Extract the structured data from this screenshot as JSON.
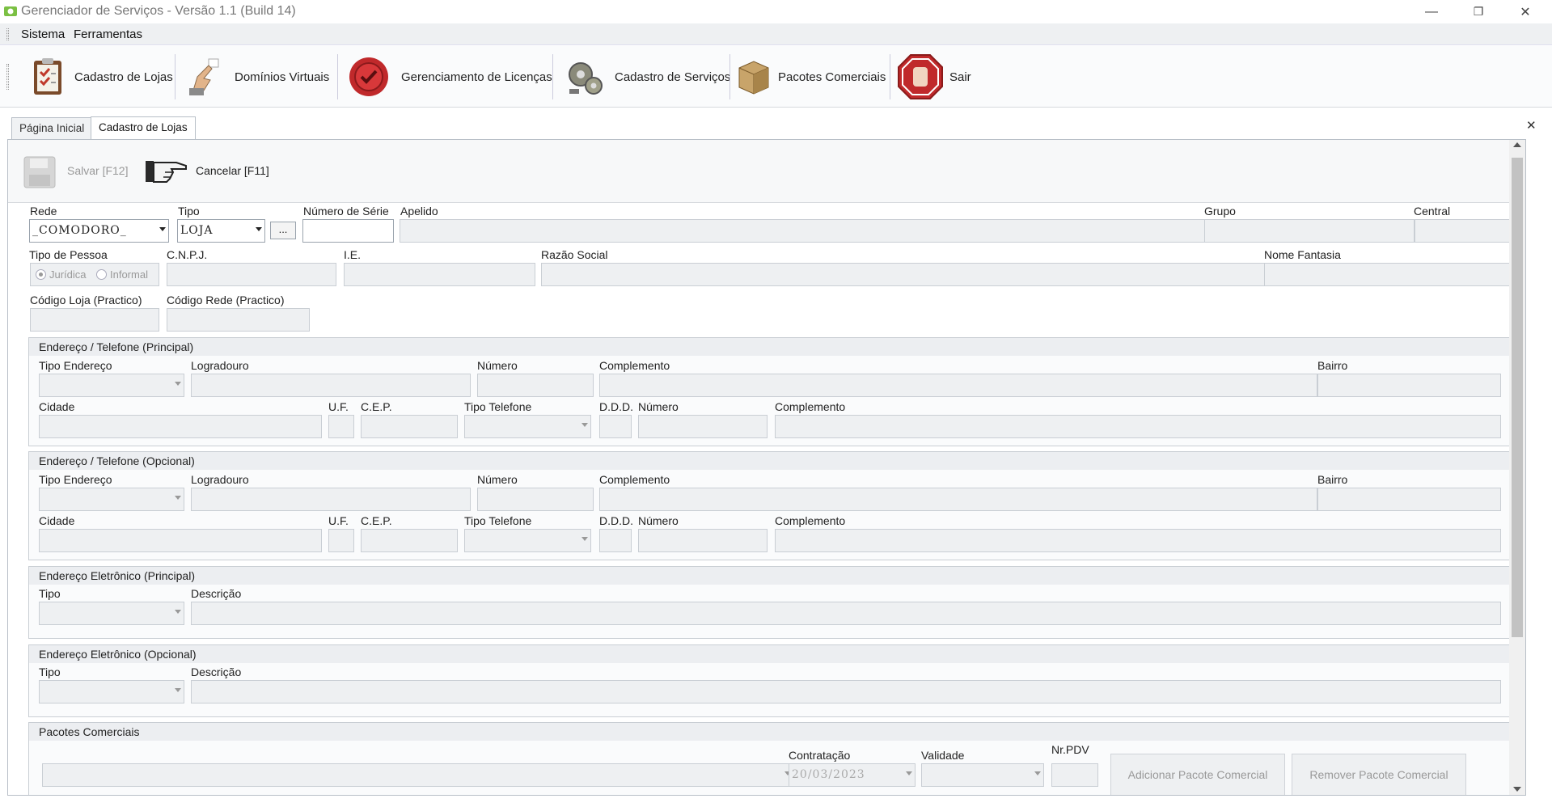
{
  "window": {
    "title": "Gerenciador de Serviços - Versão 1.1 (Build 14)",
    "minimize": "—",
    "restore": "❐",
    "close": "✕"
  },
  "menu": {
    "items": [
      "Sistema",
      "Ferramentas"
    ]
  },
  "toolbar": {
    "items": [
      {
        "label": "Cadastro de Lojas",
        "icon": "clipboard-icon"
      },
      {
        "label": "Domínios Virtuais",
        "icon": "hand-pointer-icon"
      },
      {
        "label": "Gerenciamento de Licenças",
        "icon": "wax-seal-icon"
      },
      {
        "label": "Cadastro de Serviços",
        "icon": "gears-icon"
      },
      {
        "label": "Pacotes Comerciais",
        "icon": "box-icon"
      },
      {
        "label": "Sair",
        "icon": "stop-hand-icon"
      }
    ]
  },
  "tabs": {
    "items": [
      "Página Inicial",
      "Cadastro de Lojas"
    ],
    "close": "✕"
  },
  "actions": {
    "save": "Salvar [F12]",
    "cancel": "Cancelar [F11]"
  },
  "form": {
    "rede": {
      "label": "Rede",
      "value": "_COMODORO_"
    },
    "tipo": {
      "label": "Tipo",
      "value": "LOJA"
    },
    "ellipsis": "...",
    "numero_serie": {
      "label": "Número de Série"
    },
    "apelido": {
      "label": "Apelido"
    },
    "grupo": {
      "label": "Grupo"
    },
    "central": {
      "label": "Central"
    },
    "tipo_pessoa": {
      "label": "Tipo de Pessoa",
      "opt1": "Jurídica",
      "opt2": "Informal"
    },
    "cnpj": {
      "label": "C.N.P.J."
    },
    "ie": {
      "label": "I.E."
    },
    "razao_social": {
      "label": "Razão Social"
    },
    "nome_fantasia": {
      "label": "Nome Fantasia"
    },
    "codigo_loja": {
      "label": "Código Loja (Practico)"
    },
    "codigo_rede": {
      "label": "Código Rede (Practico)"
    }
  },
  "address_labels": {
    "tipo_endereco": "Tipo Endereço",
    "logradouro": "Logradouro",
    "numero": "Número",
    "complemento": "Complemento",
    "bairro": "Bairro",
    "cidade": "Cidade",
    "uf": "U.F.",
    "cep": "C.E.P.",
    "tipo_telefone": "Tipo Telefone",
    "ddd": "D.D.D.",
    "numero_tel": "Número",
    "complemento_tel": "Complemento"
  },
  "groups": {
    "addr_principal": "Endereço / Telefone (Principal)",
    "addr_opcional": "Endereço / Telefone (Opcional)",
    "email_principal": "Endereço Eletrônico (Principal)",
    "email_opcional": "Endereço Eletrônico (Opcional)",
    "pacotes": "Pacotes Comerciais"
  },
  "email_labels": {
    "tipo": "Tipo",
    "descricao": "Descrição"
  },
  "pacotes": {
    "contratacao_label": "Contratação",
    "contratacao_value": "20/03/2023",
    "validade_label": "Validade",
    "nrpdv_label": "Nr.PDV",
    "add_button": "Adicionar Pacote Comercial",
    "remove_button": "Remover Pacote Comercial"
  }
}
